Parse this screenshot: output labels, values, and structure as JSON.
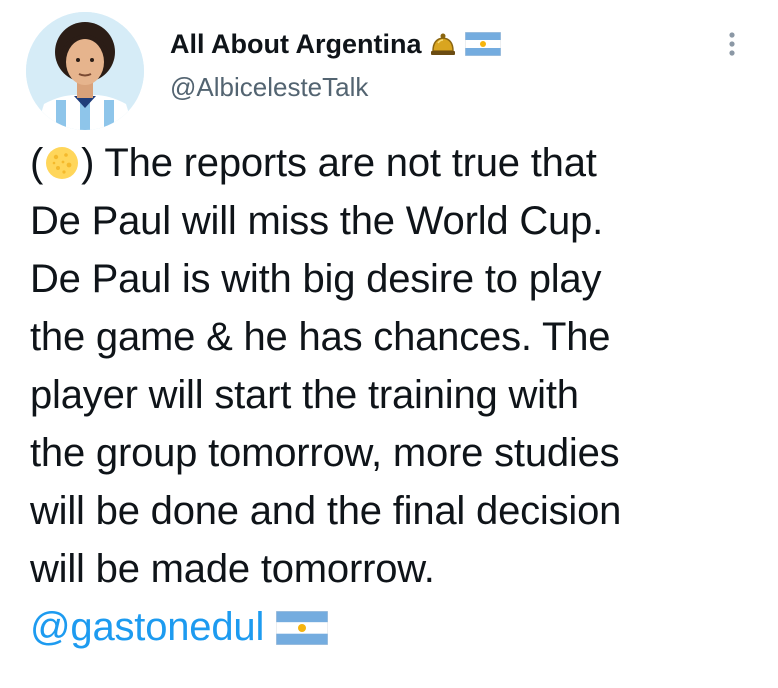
{
  "author": {
    "name": "All About Argentina",
    "handle": "@AlbicelesteTalk",
    "name_emojis": [
      "bell-icon",
      "argentina-flag-icon"
    ]
  },
  "tweet": {
    "lines": [
      {
        "before_emoji": "(",
        "emoji": "yellow-circle-icon",
        "after_emoji": ") The reports are not true that"
      },
      {
        "text": "De Paul will miss the World Cup."
      },
      {
        "text": "De Paul is with big desire to play"
      },
      {
        "text": "the game & he has chances. The"
      },
      {
        "text": "player will start the training with"
      },
      {
        "text": "the group tomorrow, more studies"
      },
      {
        "text": "will be done and the final decision"
      },
      {
        "text": "will be made tomorrow."
      }
    ],
    "mention": "@gastonedul",
    "mention_emoji": "argentina-flag-icon"
  },
  "colors": {
    "text": "#0f1419",
    "secondary": "#536471",
    "link": "#1d9bf0",
    "flag_blue": "#74acdf",
    "sun": "#f6b40e"
  }
}
